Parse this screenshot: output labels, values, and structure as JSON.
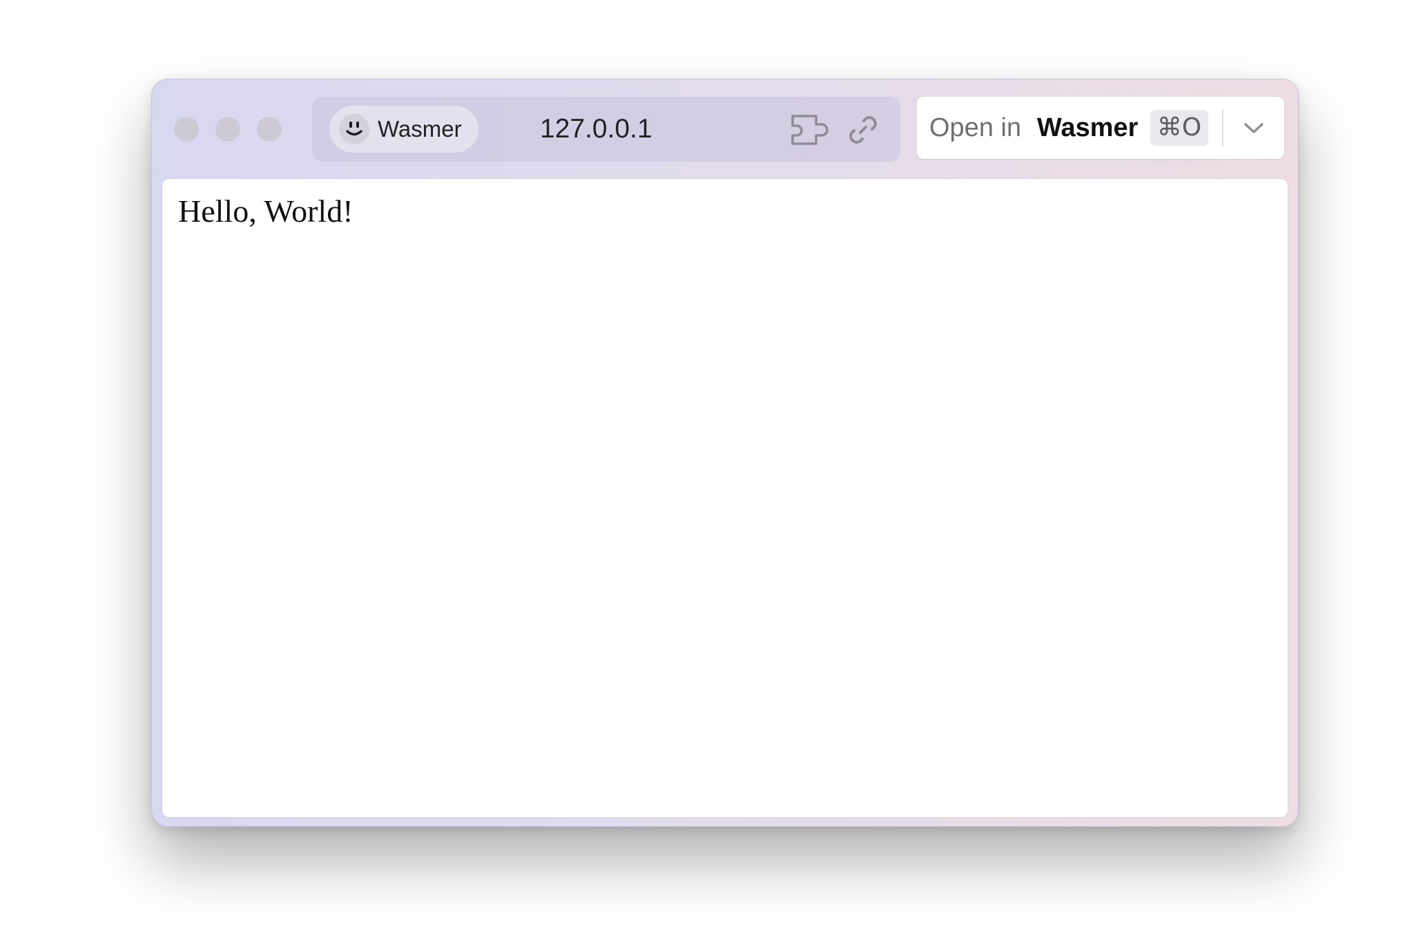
{
  "toolbar": {
    "site_name": "Wasmer",
    "address": "127.0.0.1",
    "open_prefix": "Open in",
    "open_app": "Wasmer",
    "shortcut": "⌘O"
  },
  "page": {
    "body_text": "Hello, World!"
  },
  "icons": {
    "site": "smiley-icon",
    "extension": "extension-icon",
    "link": "link-icon",
    "dropdown": "chevron-down-icon"
  },
  "colors": {
    "window_gradient_start": "#d9d8f1",
    "window_gradient_end": "#eedde3",
    "traffic_light": "#cdcad6"
  }
}
